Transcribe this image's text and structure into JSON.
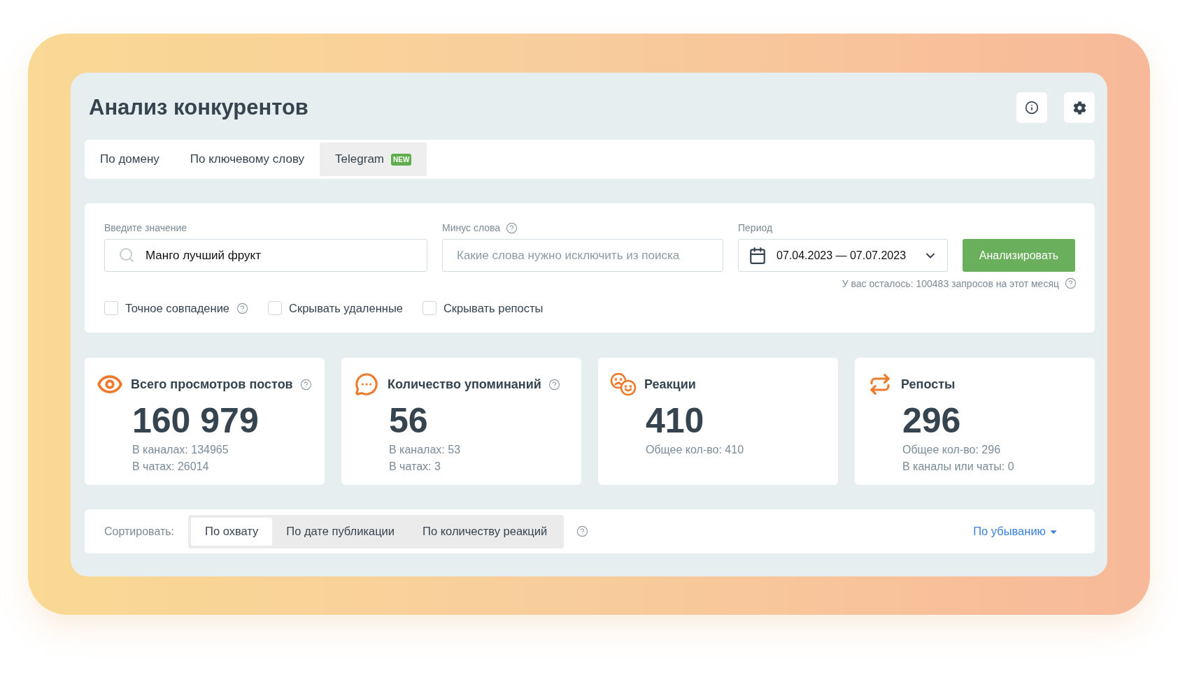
{
  "title": "Анализ конкурентов",
  "tabs": [
    {
      "label": "По домену",
      "selected": false
    },
    {
      "label": "По ключевому слову",
      "selected": false
    },
    {
      "label": "Telegram",
      "badge": "NEW",
      "selected": true
    }
  ],
  "search": {
    "label": "Введите значение",
    "value": "Манго лучший фрукт"
  },
  "minus_words": {
    "label": "Минус слова",
    "help": true,
    "placeholder": "Какие слова нужно исключить из поиска"
  },
  "period": {
    "label": "Период",
    "value": "07.04.2023 — 07.07.2023"
  },
  "analyze_button": "Анализировать",
  "quota_note": {
    "text": "У вас осталось: 100483 запросов на этот месяц",
    "help": true
  },
  "options": [
    {
      "label": "Точное совпадение",
      "checked": false,
      "help": true
    },
    {
      "label": "Скрывать удаленные",
      "checked": false,
      "help": false
    },
    {
      "label": "Скрывать репосты",
      "checked": false,
      "help": false
    }
  ],
  "stats": [
    {
      "kind": "views",
      "title": "Всего просмотров постов",
      "help": true,
      "value": "160 979",
      "details": [
        "В каналах: 134965",
        "В чатах: 26014"
      ]
    },
    {
      "kind": "mentions",
      "title": "Количество упоминаний",
      "help": true,
      "value": "56",
      "details": [
        "В каналах: 53",
        "В чатах: 3"
      ]
    },
    {
      "kind": "reactions",
      "title": "Реакции",
      "help": false,
      "value": "410",
      "details": [
        "Общее кол-во: 410"
      ]
    },
    {
      "kind": "reposts",
      "title": "Репосты",
      "help": false,
      "value": "296",
      "details": [
        "Общее кол-во: 296",
        "В каналы или чаты: 0"
      ]
    }
  ],
  "sort": {
    "label": "Сортировать:",
    "help": true,
    "options": [
      {
        "label": "По охвату",
        "selected": true
      },
      {
        "label": "По дате публикации",
        "selected": false
      },
      {
        "label": "По количеству реакций",
        "selected": false
      }
    ],
    "order": "По убыванию"
  }
}
